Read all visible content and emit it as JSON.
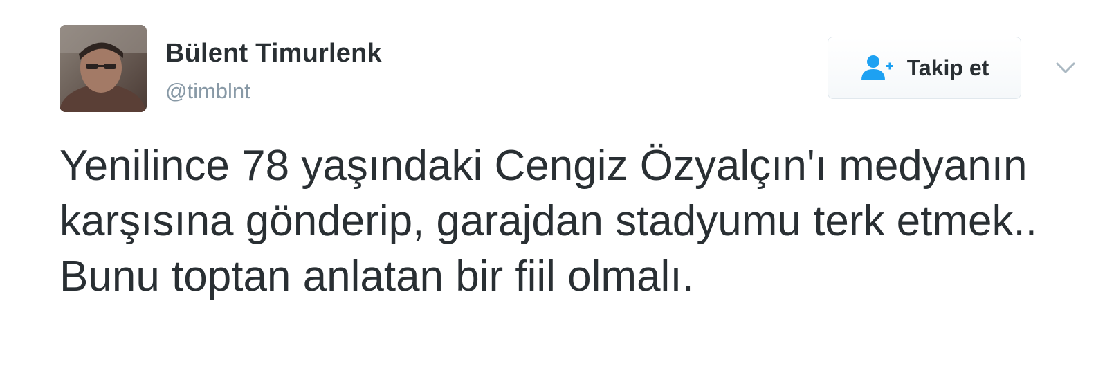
{
  "user": {
    "display_name": "Bülent Timurlenk",
    "handle": "@timblnt"
  },
  "follow_button": {
    "label": "Takip et",
    "icon": "add-user-icon"
  },
  "menu": {
    "icon": "chevron-down-icon"
  },
  "tweet": {
    "text": "Yenilince 78 yaşındaki Cengiz Özyalçın'ı medyanın karşısına gönderip, garajdan stadyumu terk etmek.. Bunu toptan anlatan bir fiil olmalı."
  },
  "colors": {
    "text": "#292f33",
    "handle": "#8899a6",
    "accent": "#1da1f2",
    "button_border": "#e1e8ed"
  }
}
